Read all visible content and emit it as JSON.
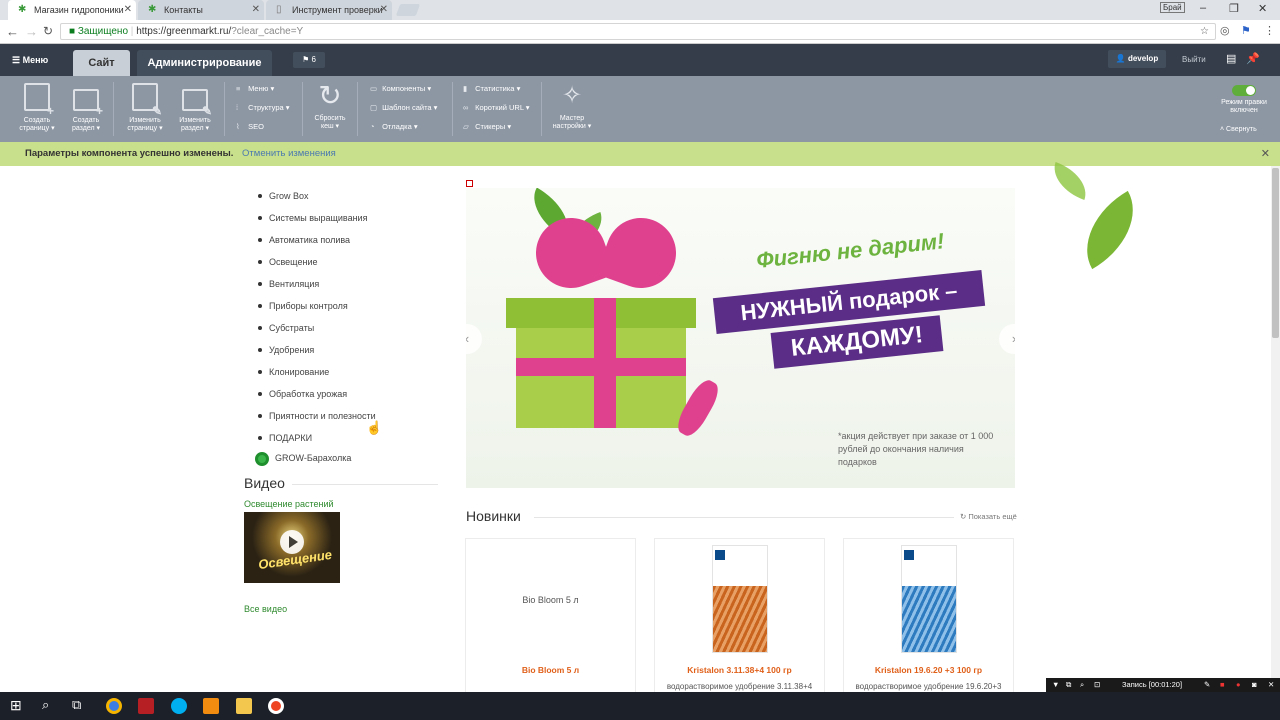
{
  "browser": {
    "tabs": [
      {
        "title": "Магазин гидропоники",
        "active": true
      },
      {
        "title": "Контакты",
        "active": false
      },
      {
        "title": "Инструмент проверки",
        "active": false
      }
    ],
    "profile_label": "Брай",
    "secure_label": "Защищено",
    "url_host": "https://greenmarkt.ru/",
    "url_path": "?clear_cache=Y"
  },
  "admin": {
    "menu_label": "Меню",
    "tab_site": "Сайт",
    "tab_admin": "Администрирование",
    "notifications_count": "6",
    "user": "develop",
    "logout": "Выйти"
  },
  "toolbar": {
    "buttons": [
      {
        "label1": "Создать",
        "label2": "страницу"
      },
      {
        "label1": "Создать",
        "label2": "раздел"
      },
      {
        "label1": "Изменить",
        "label2": "страницу"
      },
      {
        "label1": "Изменить",
        "label2": "раздел"
      }
    ],
    "col1": [
      "Меню",
      "Структура",
      "SEO"
    ],
    "reset_cache": {
      "label1": "Сбросить",
      "label2": "кеш"
    },
    "col2": [
      "Компоненты",
      "Шаблон сайта",
      "Отладка"
    ],
    "col3": [
      "Статистика",
      "Короткий URL",
      "Стикеры"
    ],
    "wizard": {
      "label1": "Мастер",
      "label2": "настройки"
    },
    "edit_mode": {
      "label1": "Режим правки",
      "label2": "включен"
    },
    "collapse": "Свернуть"
  },
  "notice": {
    "message": "Параметры компонента успешно изменены.",
    "undo": "Отменить изменения"
  },
  "catalog_menu": [
    "Grow Box",
    "Системы выращивания",
    "Автоматика полива",
    "Освещение",
    "Вентиляция",
    "Приборы контроля",
    "Субстраты",
    "Удобрения",
    "Клонирование",
    "Обработка урожая",
    "Приятности и полезности",
    "ПОДАРКИ"
  ],
  "grow_link": "GROW-Барахолка",
  "video": {
    "title": "Видео",
    "link": "Освещение растений",
    "thumb_caption": "Освещение",
    "all": "Все видео"
  },
  "banner": {
    "line1": "Фигню не дарим!",
    "line2": "НУЖНЫЙ подарок –",
    "line3": "КАЖДОМУ!",
    "fine_print": "*акция действует при заказе от 1 000 рублей до окончания наличия подарков"
  },
  "new_products": {
    "title": "Новинки",
    "show_more": "Показать ещё",
    "items": [
      {
        "name": "Bio Bloom 5 л",
        "image_alt": "Bio Bloom 5 л",
        "desc": ""
      },
      {
        "name": "Kristalon 3.11.38+4 100 гр",
        "image_alt": "",
        "desc": "водорастворимое удобрение 3.11.38+4"
      },
      {
        "name": "Kristalon 19.6.20 +3 100 гр",
        "image_alt": "",
        "desc": "водорастворимое удобрение 19.6.20+3"
      }
    ]
  },
  "recorder": {
    "label": "Запись [00:01:20]"
  },
  "colors": {
    "admin_bar": "#343d49",
    "toolbar": "#8d97a4",
    "notice": "#c8df8c",
    "accent_green": "#2f8a2f",
    "product_name": "#e0601a",
    "banner_purple": "#5b2d86",
    "ribbon_pink": "#e0418f"
  }
}
